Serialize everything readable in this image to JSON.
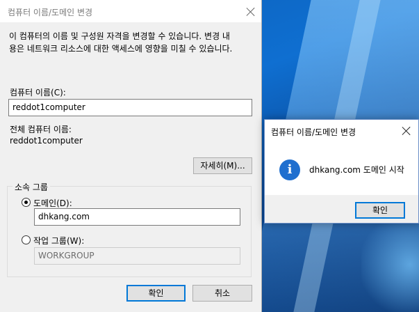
{
  "main_dialog": {
    "title": "컴퓨터 이름/도메인 변경",
    "description_line1": "이 컴퓨터의 이름 및 구성원 자격을 변경할 수 있습니다. 변경 내",
    "description_line2": "용은 네트워크 리소스에 대한 액세스에 영향을 미칠 수 있습니다.",
    "computer_name_label": "컴퓨터 이름(C):",
    "computer_name_value": "reddot1computer",
    "full_name_label": "전체 컴퓨터 이름:",
    "full_name_value": "reddot1computer",
    "more_button": "자세히(M)...",
    "member_of_legend": "소속 그룹",
    "domain_label": "도메인(D):",
    "domain_value": "dhkang.com",
    "domain_checked": true,
    "workgroup_label": "작업 그룹(W):",
    "workgroup_value": "WORKGROUP",
    "workgroup_checked": false,
    "ok_button": "확인",
    "cancel_button": "취소"
  },
  "message_box": {
    "title": "컴퓨터 이름/도메인 변경",
    "icon": "info-icon",
    "message": "dhkang.com 도메인 시작",
    "ok_button": "확인"
  }
}
